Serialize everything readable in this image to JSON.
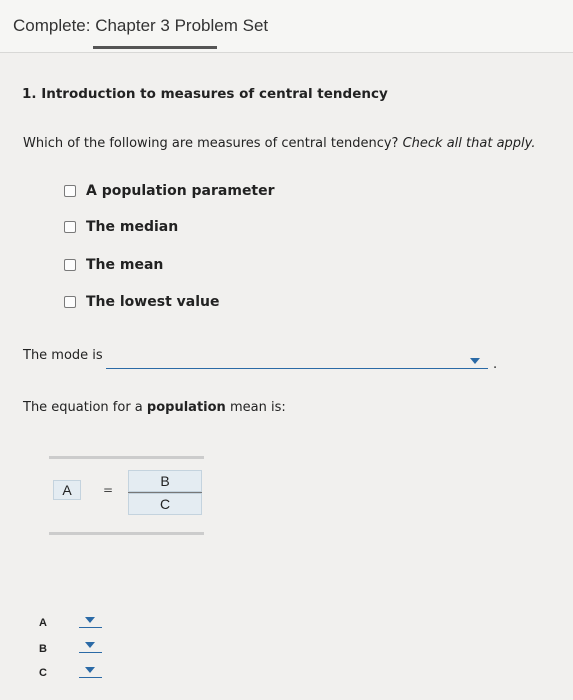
{
  "header": {
    "title": "Complete: Chapter 3 Problem Set"
  },
  "question": {
    "title": "1. Introduction to measures of central tendency",
    "prompt": "Which of the following are measures of central tendency?",
    "prompt_instruction": "Check all that apply."
  },
  "options": [
    {
      "label": "A population parameter",
      "checked": false
    },
    {
      "label": "The median",
      "checked": false
    },
    {
      "label": "The mean",
      "checked": false
    },
    {
      "label": "The lowest value",
      "checked": false
    }
  ],
  "mode": {
    "label": "The mode is",
    "selected": "",
    "period": "."
  },
  "equation": {
    "label_prefix": "The equation for a",
    "label_bold": "population",
    "label_suffix": "mean is:",
    "lhs": "A",
    "equals": "=",
    "numerator": "B",
    "denominator": "C"
  },
  "dropdowns": [
    {
      "letter": "A",
      "selected": ""
    },
    {
      "letter": "B",
      "selected": ""
    },
    {
      "letter": "C",
      "selected": ""
    }
  ],
  "colors": {
    "accent": "#2b6aa6",
    "cell_bg": "#e4ecf2"
  }
}
